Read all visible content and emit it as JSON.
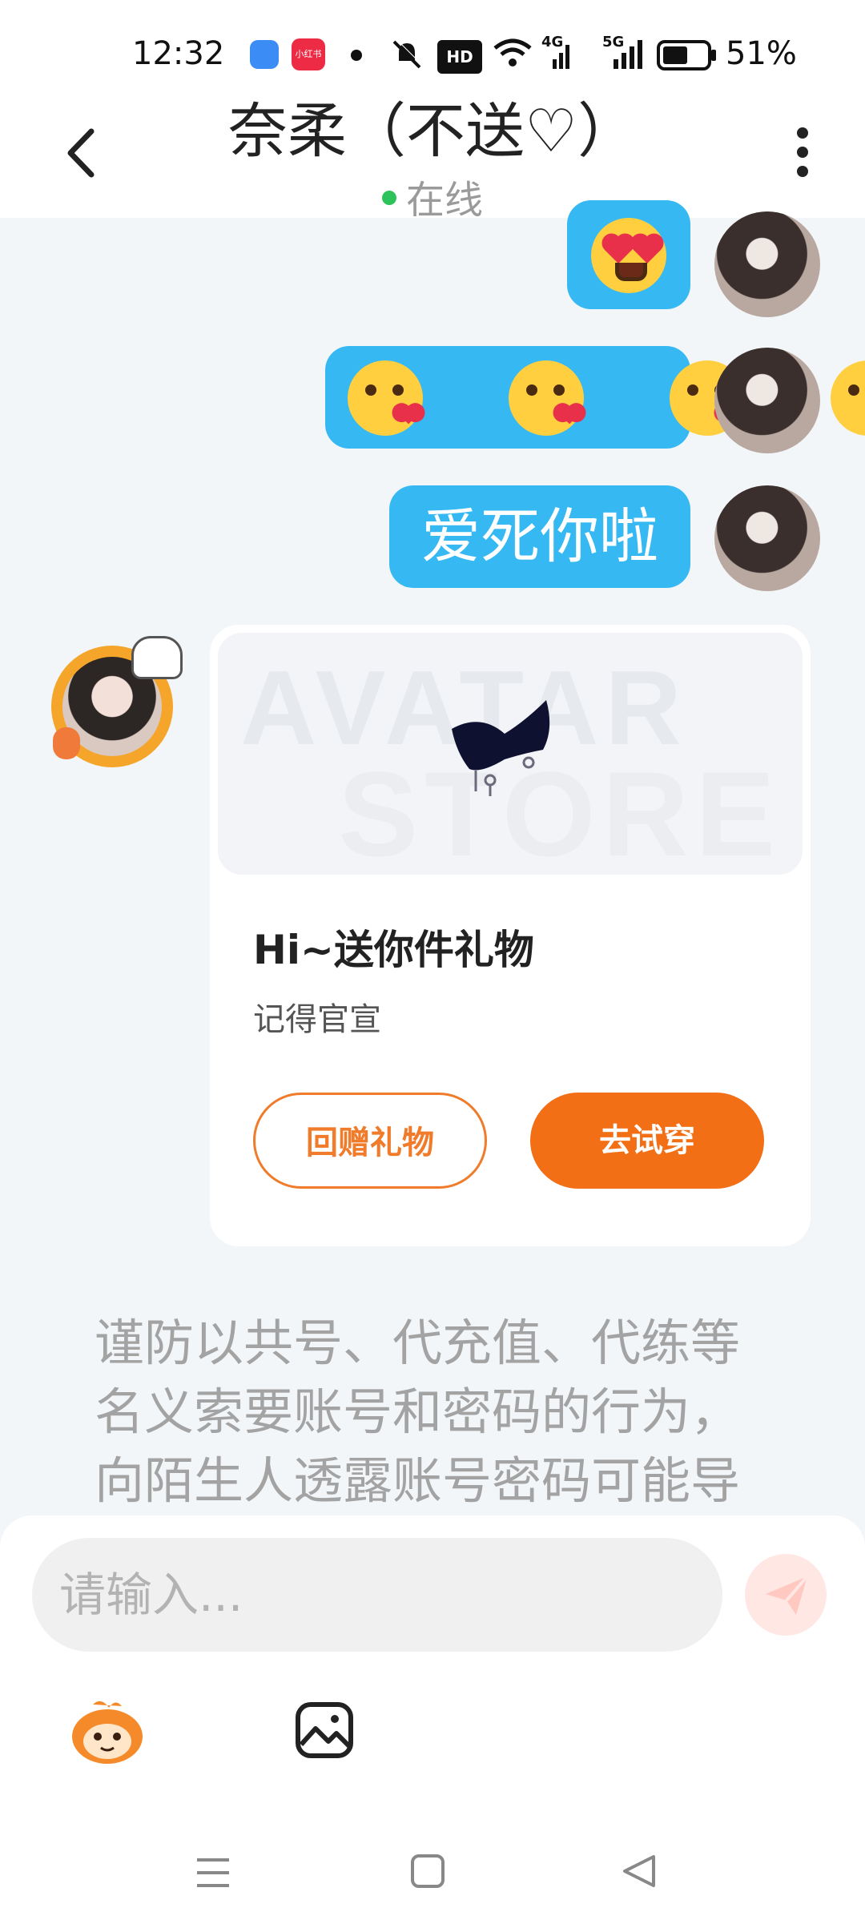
{
  "status_bar": {
    "time": "12:32",
    "battery": "51%",
    "app_badge": "小红书",
    "hd_badge": "HD",
    "network_4g": "4G",
    "network_5g": "5G"
  },
  "header": {
    "title": "奈柔（不送♡）",
    "status": "在线"
  },
  "messages": [
    {
      "side": "right",
      "type": "emoji",
      "emojis": [
        "heart-eyes-emoji"
      ]
    },
    {
      "side": "right",
      "type": "emoji",
      "emojis": [
        "kiss-emoji",
        "kiss-emoji",
        "kiss-emoji",
        "kiss-emoji"
      ]
    },
    {
      "side": "right",
      "type": "text",
      "text": "爱死你啦"
    }
  ],
  "gift_card": {
    "watermark_line1": "AVATAR",
    "watermark_line2": "STORE",
    "title": "Hi~送你件礼物",
    "subtitle": "记得官宣",
    "button_return": "回赠礼物",
    "button_try": "去试穿"
  },
  "warning_lines": [
    "谨防以共号、代充值、代练等",
    "名义索要账号和密码的行为，",
    "向陌生人透露账号密码可能导"
  ],
  "input": {
    "placeholder": "请输入..."
  },
  "colors": {
    "bubble": "#36b8f3",
    "accent_orange": "#f26f16",
    "online_green": "#2ec25b"
  }
}
